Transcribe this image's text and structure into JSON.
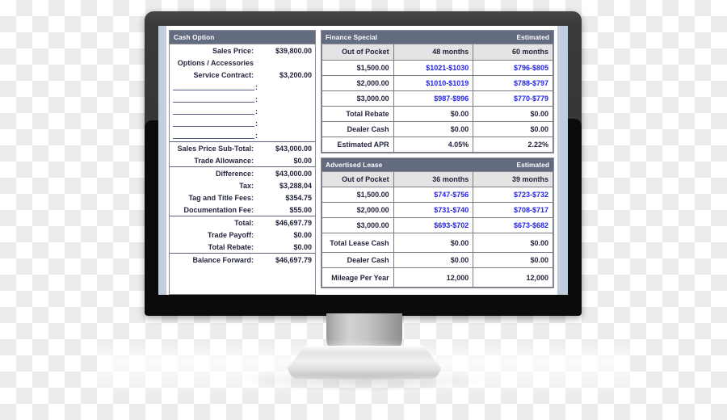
{
  "cash_option": {
    "title": "Cash Option",
    "groups": [
      {
        "rows": [
          {
            "label": "Sales Price:",
            "value": "$39,800.00"
          },
          {
            "label": "Options / Accessories",
            "value": ""
          },
          {
            "label": "Service Contract:",
            "value": "$3,200.00"
          }
        ],
        "blank_lines": 5,
        "blank_suffix": ":"
      },
      {
        "rows": [
          {
            "label": "Sales Price Sub-Total:",
            "value": "$43,000.00"
          },
          {
            "label": "Trade Allowance:",
            "value": "$0.00"
          }
        ]
      },
      {
        "rows": [
          {
            "label": "Difference:",
            "value": "$43,000.00"
          },
          {
            "label": "Tax:",
            "value": "$3,288.04"
          },
          {
            "label": "Tag and Title Fees:",
            "value": "$354.75"
          },
          {
            "label": "Documentation Fee:",
            "value": "$55.00"
          }
        ]
      },
      {
        "rows": [
          {
            "label": "Total:",
            "value": "$46,697.79"
          },
          {
            "label": "Trade Payoff:",
            "value": "$0.00"
          },
          {
            "label": "Total Rebate:",
            "value": "$0.00"
          }
        ]
      },
      {
        "rows": [
          {
            "label": "Balance Forward:",
            "value": "$46,697.79"
          }
        ]
      }
    ]
  },
  "finance_special": {
    "title": "Finance Special",
    "estimated_label": "Estimated",
    "columns": [
      "Out of Pocket",
      "48 months",
      "60 months"
    ],
    "rows": [
      {
        "label": "$1,500.00",
        "c1": "$1021-$1030",
        "c2": "$796-$805",
        "blue": true
      },
      {
        "label": "$2,000.00",
        "c1": "$1010-$1019",
        "c2": "$788-$797",
        "blue": true
      },
      {
        "label": "$3,000.00",
        "c1": "$987-$996",
        "c2": "$770-$779",
        "blue": true
      },
      {
        "label": "Total Rebate",
        "c1": "$0.00",
        "c2": "$0.00",
        "blue": false
      },
      {
        "label": "Dealer Cash",
        "c1": "$0.00",
        "c2": "$0.00",
        "blue": false
      },
      {
        "label": "Estimated APR",
        "c1": "4.05%",
        "c2": "2.22%",
        "blue": false
      }
    ]
  },
  "advertised_lease": {
    "title": "Advertised Lease",
    "estimated_label": "Estimated",
    "columns": [
      "Out of Pocket",
      "36 months",
      "39 months"
    ],
    "rows": [
      {
        "label": "$1,500.00",
        "c1": "$747-$756",
        "c2": "$723-$732",
        "blue": true
      },
      {
        "label": "$2,000.00",
        "c1": "$731-$740",
        "c2": "$708-$717",
        "blue": true
      },
      {
        "label": "$3,000.00",
        "c1": "$693-$702",
        "c2": "$673-$682",
        "blue": true
      },
      {
        "label": "Total Lease Cash",
        "c1": "$0.00",
        "c2": "$0.00",
        "blue": false
      },
      {
        "label": "Dealer Cash",
        "c1": "$0.00",
        "c2": "$0.00",
        "blue": false
      },
      {
        "label": "Mileage Per Year",
        "c1": "12,000",
        "c2": "12,000",
        "blue": false
      }
    ]
  },
  "colors": {
    "panel_header_bg": "#636b80",
    "column_header_bg": "#e4e4e4",
    "text_dark": "#23253d",
    "payment_blue": "#2424e0",
    "bezel": "#333333",
    "page_margin": "#c2cddd"
  }
}
